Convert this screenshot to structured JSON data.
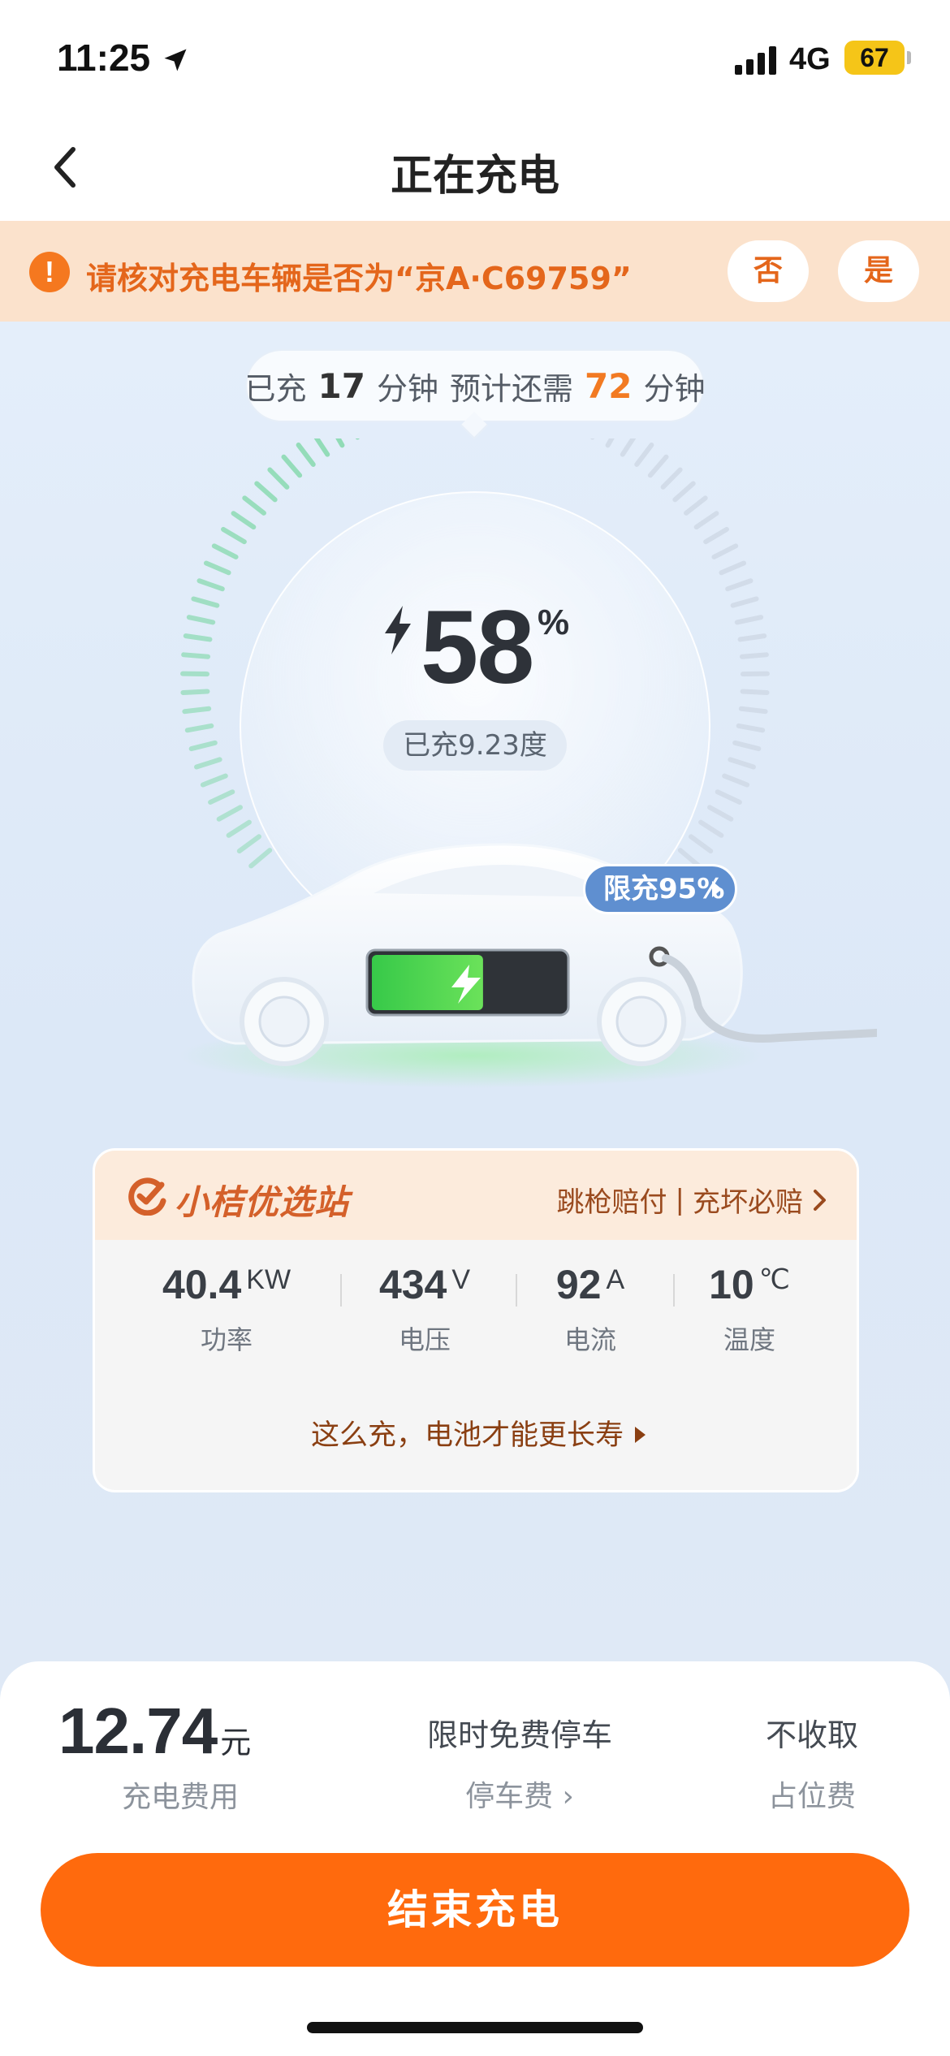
{
  "status_bar": {
    "time": "11:25",
    "network": "4G",
    "battery": "67"
  },
  "nav": {
    "title": "正在充电"
  },
  "alert": {
    "text": "请核对充电车辆是否为“京A·C69759”",
    "no_label": "否",
    "yes_label": "是"
  },
  "time_info": {
    "charged_prefix": "已充",
    "charged_minutes": "17",
    "minutes_unit": "分钟",
    "remaining_prefix": "预计还需",
    "remaining_minutes": "72",
    "minutes_unit2": "分钟"
  },
  "gauge": {
    "percent": "58",
    "percent_unit": "%",
    "level_fraction": 0.58,
    "charged_energy": "已充9.23度",
    "limit_label": "限充95%"
  },
  "station": {
    "name": "小桔优选站",
    "guarantee_1": "跳枪赔付",
    "separator": "|",
    "guarantee_2": "充坏必赔",
    "metrics": [
      {
        "value": "40.4",
        "unit": "KW",
        "label": "功率"
      },
      {
        "value": "434",
        "unit": "V",
        "label": "电压"
      },
      {
        "value": "92",
        "unit": "A",
        "label": "电流"
      },
      {
        "value": "10",
        "unit": "℃",
        "label": "温度"
      }
    ],
    "tip_link": "这么充，电池才能更长寿"
  },
  "bottom": {
    "fee_amount": "12.74",
    "fee_unit": "元",
    "fee_label": "充电费用",
    "parking_top": "限时免费停车",
    "parking_bottom": "停车费 ›",
    "occupy_top": "不收取",
    "occupy_bottom": "占位费",
    "end_button": "结束充电"
  },
  "colors": {
    "accent_orange": "#ff6a0d",
    "gauge_green": "#7fd8a8",
    "gauge_grey": "#cfd9e6",
    "limit_blue": "#5f8fd0"
  }
}
